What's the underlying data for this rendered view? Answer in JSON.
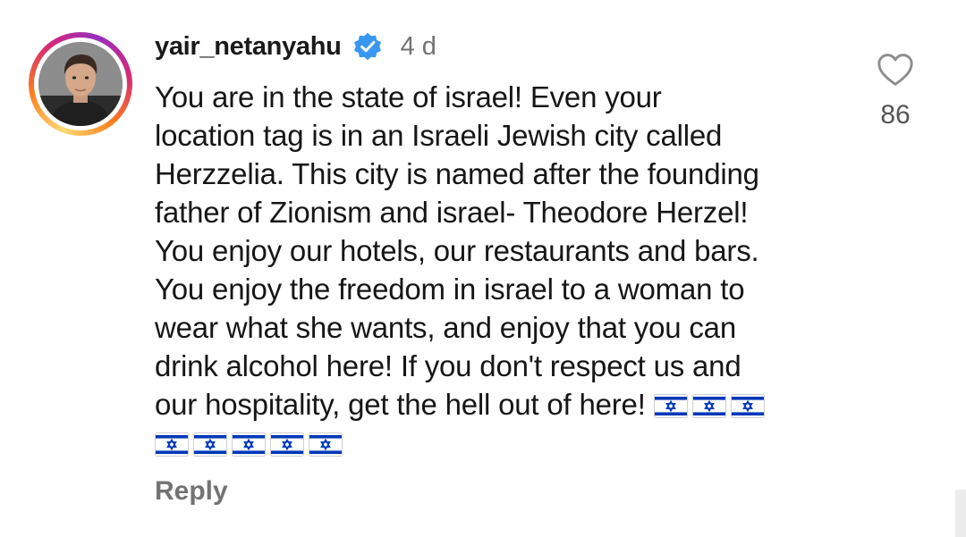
{
  "comment": {
    "username": "yair_netanyahu",
    "verified": true,
    "verified_color": "#3897f0",
    "time": "4 d",
    "lines": [
      "You are in the state of israel! Even your",
      "location tag is in an Israeli Jewish city called",
      "Herzzelia. This city is named after the founding",
      "father of Zionism and israel- Theodore Herzel!",
      "You enjoy our hotels, our restaurants and bars.",
      "You enjoy the freedom in israel to a woman to",
      "wear what she wants, and enjoy that you can",
      "drink alcohol here!  If you don't respect us and",
      "our hospitality, get the hell out of here!"
    ],
    "flag_emoji": "🇮🇱",
    "flags_on_last_text_line": 3,
    "flags_on_extra_line": 5,
    "reply_label": "Reply",
    "like_icon": "heart-outline-icon",
    "like_count": "86"
  },
  "colors": {
    "avatar_ring": [
      "#feda75",
      "#fa7e1e",
      "#d62976",
      "#962fbf"
    ],
    "flag_blue": "#0038b8",
    "muted_text": "#737373"
  }
}
